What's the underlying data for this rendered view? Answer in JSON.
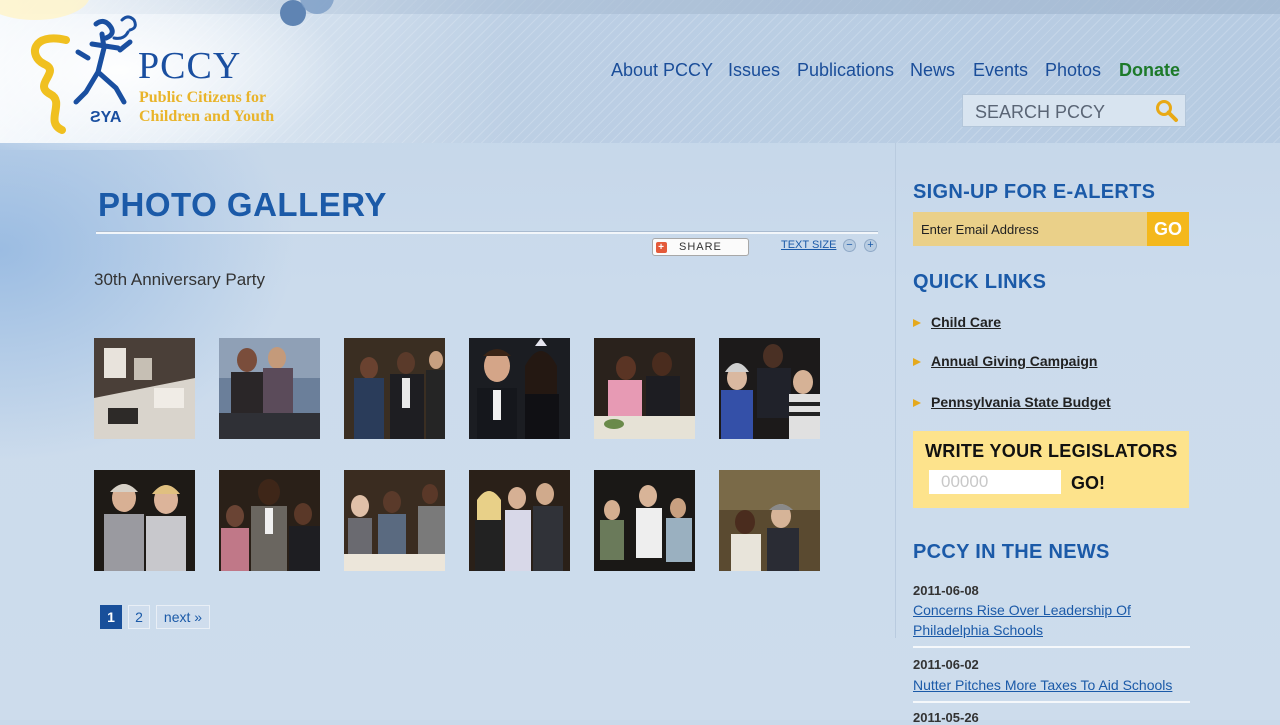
{
  "header": {
    "logo": {
      "name": "PCCY",
      "tagline_line1": "Public Citizens for",
      "tagline_line2": "Children and Youth"
    },
    "nav": [
      {
        "label": "About PCCY"
      },
      {
        "label": "Issues"
      },
      {
        "label": "Publications"
      },
      {
        "label": "News"
      },
      {
        "label": "Events"
      },
      {
        "label": "Photos"
      },
      {
        "label": "Donate"
      }
    ],
    "search": {
      "placeholder": "SEARCH PCCY",
      "icon": "magnifier-icon"
    }
  },
  "main": {
    "page_title": "PHOTO GALLERY",
    "share_label": "SHARE",
    "text_size_label": "TEXT SIZE",
    "text_size_decrease": "−",
    "text_size_increase": "+",
    "album_title": "30th Anniversary Party",
    "photos": [
      {
        "desc": "auction-table"
      },
      {
        "desc": "guests-at-table"
      },
      {
        "desc": "group-of-guests"
      },
      {
        "desc": "man-and-pageant-queen"
      },
      {
        "desc": "guests-seated-at-dinner"
      },
      {
        "desc": "guests-chatting"
      },
      {
        "desc": "two-women"
      },
      {
        "desc": "man-with-two-women"
      },
      {
        "desc": "guests-at-dinner-table"
      },
      {
        "desc": "group-standing"
      },
      {
        "desc": "group-in-crowd"
      },
      {
        "desc": "couple-in-ballroom"
      }
    ],
    "pagination": {
      "pages": [
        "1",
        "2"
      ],
      "current": "1",
      "next_label": "next »"
    }
  },
  "sidebar": {
    "ealerts": {
      "heading": "SIGN-UP FOR E-ALERTS",
      "placeholder": "Enter Email Address",
      "go_label": "GO"
    },
    "quick_links": {
      "heading": "QUICK LINKS",
      "items": [
        {
          "label": "Child Care"
        },
        {
          "label": "Annual Giving Campaign"
        },
        {
          "label": "Pennsylvania State Budget"
        }
      ]
    },
    "legislators": {
      "heading": "WRITE YOUR LEGISLATORS",
      "zip_placeholder": "00000",
      "go_label": "GO!"
    },
    "news": {
      "heading": "PCCY IN THE NEWS",
      "items": [
        {
          "date": "2011-06-08",
          "title": "Concerns Rise Over Leadership Of Philadelphia Schools"
        },
        {
          "date": "2011-06-02",
          "title": "Nutter Pitches More Taxes To Aid Schools"
        },
        {
          "date": "2011-05-26",
          "title": ""
        }
      ]
    }
  },
  "colors": {
    "brand_blue": "#1b5aa8",
    "brand_yellow": "#f4b81c",
    "donate_green": "#1d7a2a",
    "page_bg": "#c9d9ea"
  }
}
